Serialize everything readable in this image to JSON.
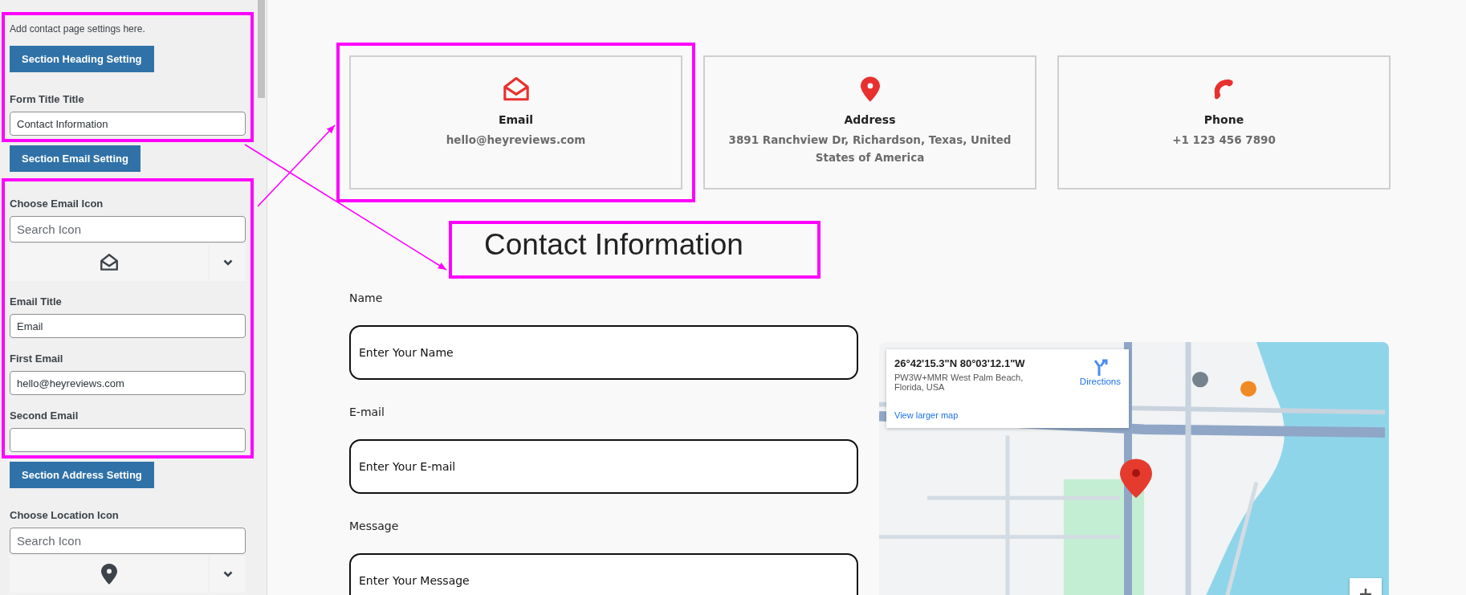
{
  "sidebar": {
    "sections": [
      {
        "highlighted": true,
        "items": [
          {
            "kind": "note",
            "text": "Add contact page settings here."
          },
          {
            "kind": "button",
            "text": "Section Heading Setting"
          },
          {
            "kind": "label",
            "text": "Form Title Title"
          },
          {
            "kind": "field",
            "value": "Contact Information"
          }
        ]
      },
      {
        "highlighted": false,
        "items": [
          {
            "kind": "button",
            "text": "Section Email Setting"
          }
        ]
      },
      {
        "highlighted": true,
        "items": [
          {
            "kind": "label",
            "text": "Choose Email Icon"
          },
          {
            "kind": "search",
            "placeholder": "Search Icon"
          },
          {
            "kind": "picker"
          },
          {
            "kind": "label",
            "text": "Email Title"
          },
          {
            "kind": "field",
            "value": "Email"
          },
          {
            "kind": "label",
            "text": "First Email"
          },
          {
            "kind": "field",
            "value": "hello@heyreviews.com"
          },
          {
            "kind": "label",
            "text": "Second Email"
          },
          {
            "kind": "field"
          }
        ]
      },
      {
        "highlighted": false,
        "items": [
          {
            "kind": "button",
            "text": "Section Address Setting"
          },
          {
            "kind": "label",
            "text": "Choose Location Icon"
          },
          {
            "kind": "search",
            "placeholder": "Search Icon"
          },
          {
            "kind": "picker"
          }
        ]
      }
    ]
  },
  "cards": [
    {
      "title": "Email",
      "text": "hello@heyreviews.com",
      "highlighted": true
    },
    {
      "title": "Address",
      "text": "3891 Ranchview Dr, Richardson, Texas, United States of America",
      "highlighted": false
    },
    {
      "title": "Phone",
      "text": "+1 123 456 7890",
      "highlighted": false
    }
  ],
  "heading": {
    "text": "Contact Information",
    "highlighted": true
  },
  "form": {
    "fields": [
      {
        "label": "Name",
        "placeholder": "Enter Your Name"
      },
      {
        "label": "E-mail",
        "placeholder": "Enter Your E-mail"
      },
      {
        "label": "Message",
        "placeholder": "Enter Your Message"
      }
    ]
  },
  "map": {
    "kind": "picture",
    "info": {
      "coordinates": "26°42'15.3\"N 80°03'12.1\"W",
      "address": "PW3W+MMR West Palm Beach, Florida, USA",
      "directions": "Directions",
      "link": "View larger map"
    }
  }
}
